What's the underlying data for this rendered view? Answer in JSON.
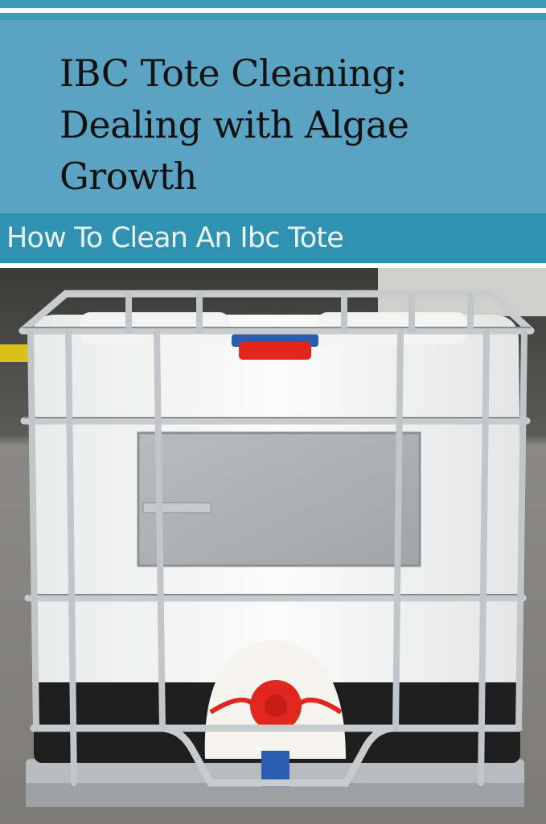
{
  "header": {
    "title": "IBC Tote Cleaning: Dealing with Algae Growth",
    "subtitle": "How To Clean An Ibc Tote",
    "colors": {
      "title_band": "#5aa3c2",
      "subtitle_band": "#2f92b1",
      "title_text": "#111111"
    }
  },
  "photo": {
    "subject": "ibc-tote-icon"
  }
}
